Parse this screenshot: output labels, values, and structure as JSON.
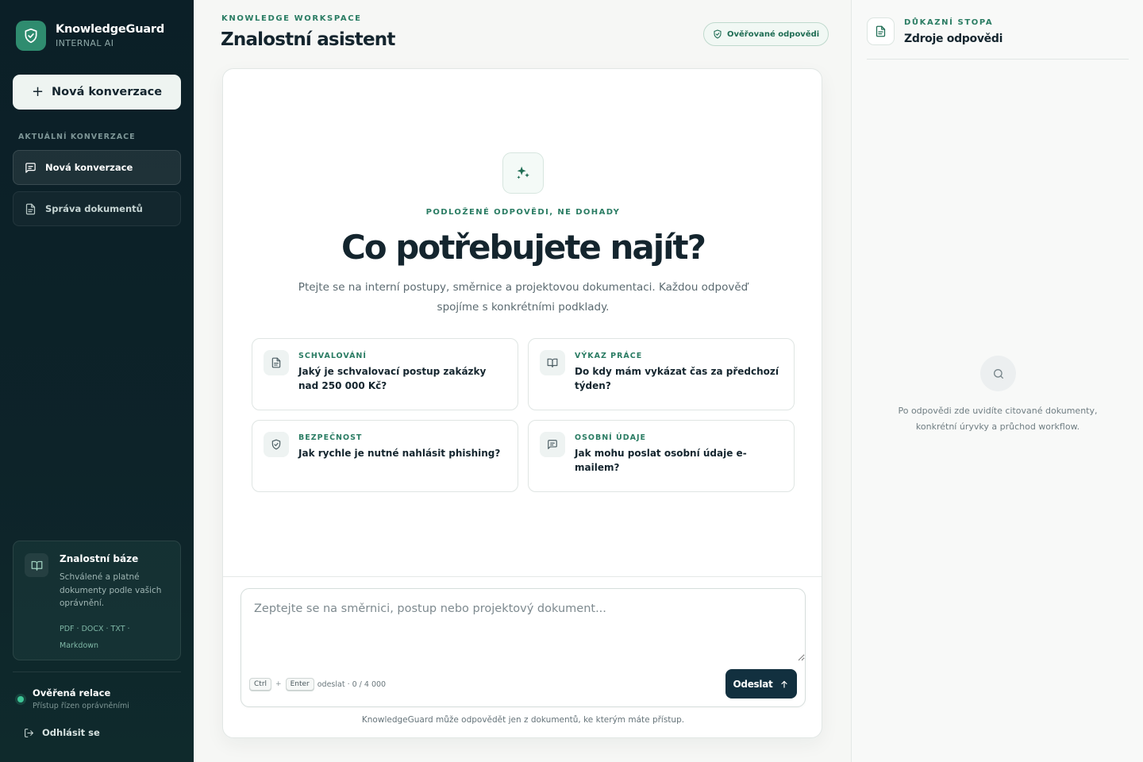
{
  "sidebar": {
    "brand_name": "KnowledgeGuard",
    "brand_sub": "INTERNAL AI",
    "new_conversation_label": "Nová konverzace",
    "section_label": "AKTUÁLNÍ KONVERZACE",
    "items": [
      {
        "label": "Nová konverzace",
        "icon": "message-icon",
        "active": true
      },
      {
        "label": "Správa dokumentů",
        "icon": "document-icon",
        "active": false
      }
    ],
    "knowledge_base": {
      "title": "Znalostní báze",
      "description": "Schválené a platné dokumenty podle vašich oprávnění.",
      "formats": "PDF · DOCX · TXT · Markdown"
    },
    "session": {
      "title": "Ověřená relace",
      "subtitle": "Přístup řízen oprávněními"
    },
    "logout_label": "Odhlásit se"
  },
  "header": {
    "eyebrow": "KNOWLEDGE WORKSPACE",
    "title": "Znalostní asistent",
    "badge": "Ověřované odpovědi"
  },
  "main": {
    "hero_eyebrow": "PODLOŽENÉ ODPOVĚDI, NE DOHADY",
    "hero_title": "Co potřebujete najít?",
    "hero_subtitle": "Ptejte se na interní postupy, směrnice a projektovou dokumentaci. Každou odpověď spojíme s konkrétními podklady.",
    "suggestions": [
      {
        "category": "SCHVALOVÁNÍ",
        "question": "Jaký je schvalovací postup zakázky nad 250 000 Kč?",
        "icon": "document-icon"
      },
      {
        "category": "VÝKAZ PRÁCE",
        "question": "Do kdy mám vykázat čas za předchozí týden?",
        "icon": "book-icon"
      },
      {
        "category": "BEZPEČNOST",
        "question": "Jak rychle je nutné nahlásit phishing?",
        "icon": "shield-icon"
      },
      {
        "category": "OSOBNÍ ÚDAJE",
        "question": "Jak mohu poslat osobní údaje e-mailem?",
        "icon": "message-icon"
      }
    ],
    "composer": {
      "placeholder": "Zeptejte se na směrnici, postup nebo projektový dokument...",
      "value": "",
      "key1": "Ctrl",
      "key_plus": "+",
      "key2": "Enter",
      "hint": "odeslat · 0 / 4 000",
      "send_label": "Odeslat"
    },
    "disclaimer": "KnowledgeGuard může odpovědět jen z dokumentů, ke kterým máte přístup."
  },
  "right_panel": {
    "eyebrow": "DŮKAZNÍ STOPA",
    "title": "Zdroje odpovědi",
    "empty_text": "Po odpovědi zde uvidíte citované dokumenty, konkrétní úryvky a průchod workflow."
  },
  "colors": {
    "accent": "#2a7c63",
    "sidebar_bg": "#0b1f27",
    "send_button": "#12303f",
    "status_online": "#3ec596"
  }
}
